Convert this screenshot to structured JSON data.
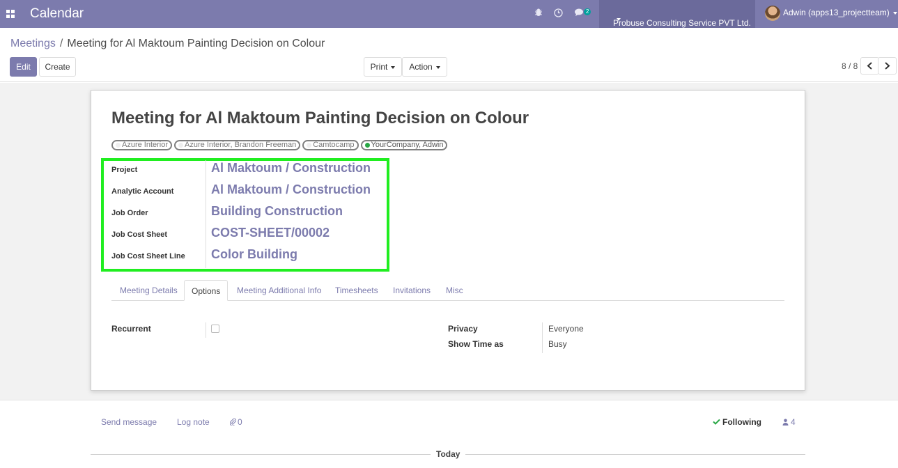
{
  "navbar": {
    "app_title": "Calendar",
    "message_count": "2",
    "company": "Probuse Consulting Service PVT Ltd.",
    "user": "Adwin (apps13_projectteam)"
  },
  "breadcrumb": {
    "parent": "Meetings",
    "separator": "/",
    "current": "Meeting for Al Maktoum Painting Decision on Colour"
  },
  "toolbar": {
    "edit_label": "Edit",
    "create_label": "Create",
    "print_label": "Print",
    "action_label": "Action",
    "pager": "8 / 8"
  },
  "record": {
    "title": "Meeting for Al Maktoum Painting Decision on Colour",
    "attendees": [
      {
        "label": "Azure Interior",
        "status_color": "#eeeeee"
      },
      {
        "label": "Azure Interior, Brandon Freeman",
        "status_color": "#eeeeee"
      },
      {
        "label": "Camtocamp",
        "status_color": "#eeeeee"
      },
      {
        "label": "YourCompany, Adwin",
        "status_color": "#28a745"
      }
    ],
    "fields": [
      {
        "label": "Project",
        "value": "Al Maktoum / Construction"
      },
      {
        "label": "Analytic Account",
        "value": "Al Maktoum / Construction"
      },
      {
        "label": "Job Order",
        "value": "Building Construction"
      },
      {
        "label": "Job Cost Sheet",
        "value": "COST-SHEET/00002"
      },
      {
        "label": "Job Cost Sheet Line",
        "value": "Color Building"
      }
    ],
    "highlight_color": "#20ee20"
  },
  "tabs": [
    {
      "label": "Meeting Details",
      "active": false
    },
    {
      "label": "Options",
      "active": true
    },
    {
      "label": "Meeting Additional Info",
      "active": false
    },
    {
      "label": "Timesheets",
      "active": false
    },
    {
      "label": "Invitations",
      "active": false
    },
    {
      "label": "Misc",
      "active": false
    }
  ],
  "options": {
    "recurrent_label": "Recurrent",
    "recurrent_checked": false,
    "privacy_label": "Privacy",
    "privacy_value": "Everyone",
    "show_time_label": "Show Time as",
    "show_time_value": "Busy"
  },
  "chatter": {
    "send_message": "Send message",
    "log_note": "Log note",
    "attachments_count": "0",
    "following": "Following",
    "followers_count": "4",
    "today": "Today"
  },
  "colors": {
    "brand": "#7c7bad",
    "brand_dark": "#6b6a9b"
  }
}
